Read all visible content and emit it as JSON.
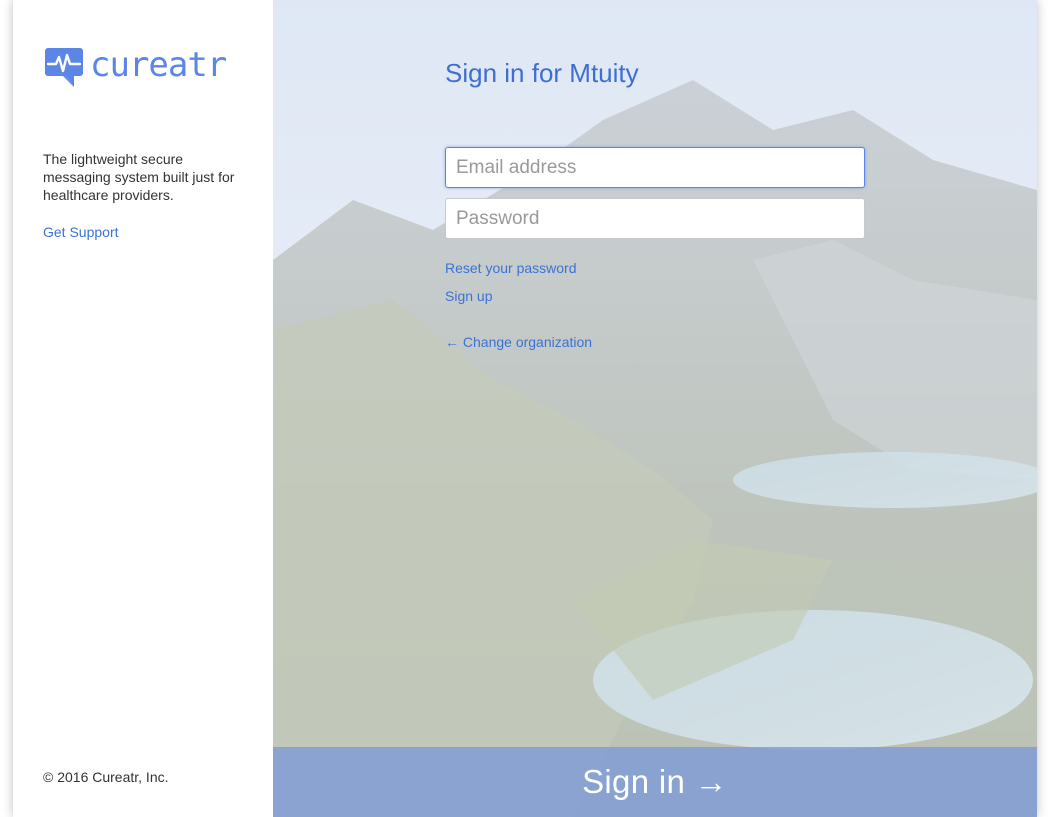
{
  "brand": {
    "name": "cureatr",
    "icon": "chat-heartbeat-icon",
    "color": "#5b86e5"
  },
  "sidebar": {
    "tagline": "The lightweight secure messaging system built just for healthcare providers.",
    "support_link": "Get Support",
    "copyright": "© 2016 Cureatr, Inc."
  },
  "signin": {
    "heading": "Sign in for Mtuity",
    "email_placeholder": "Email address",
    "email_value": "",
    "password_placeholder": "Password",
    "password_value": "",
    "reset_link": "Reset your password",
    "signup_link": "Sign up",
    "change_org_link": "← Change organization",
    "submit_label": "Sign in →"
  },
  "colors": {
    "accent": "#3e6fd0",
    "link": "#3b73d4",
    "submit_bar": "#7b98d7"
  }
}
